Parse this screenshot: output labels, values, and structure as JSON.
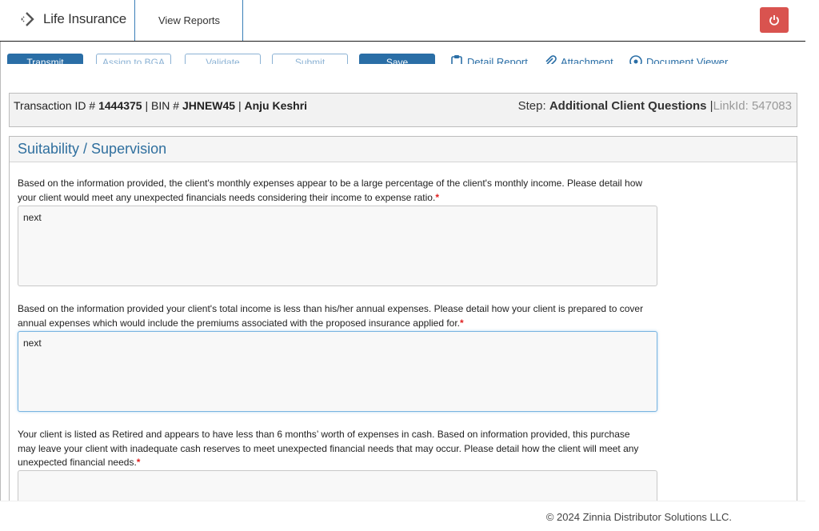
{
  "header": {
    "app_name": "Life Insurance",
    "nav_reports": "View Reports",
    "power_icon": "power-icon",
    "power_color": "#d9534f",
    "accent_color": "#2a6ea6"
  },
  "toolbar": {
    "buttons": [
      {
        "label": "Transmit",
        "style": "filled"
      },
      {
        "label": "Assign to BGA",
        "style": "outline"
      },
      {
        "label": "Validate",
        "style": "outline"
      },
      {
        "label": "Submit",
        "style": "outline"
      },
      {
        "label": "Save",
        "style": "filled"
      }
    ],
    "links": [
      {
        "label": "Detail Report",
        "icon": "clipboard-icon"
      },
      {
        "label": "Attachment",
        "icon": "paperclip-icon"
      },
      {
        "label": "Document Viewer",
        "icon": "eye-icon"
      }
    ]
  },
  "transaction": {
    "id_label": "Transaction ID #",
    "id_value": "1444375",
    "bin_label": "BIN #",
    "bin_value": "JHNEW45",
    "client_name": "Anju Keshri",
    "step_label": "Step:",
    "step_value": "Additional Client Questions",
    "link_id": "LinkId: 547083"
  },
  "section": {
    "title": "Suitability / Supervision",
    "questions": [
      {
        "text": "Based on the information provided, the client's monthly expenses appear to be a large percentage of the client's monthly income. Please detail how your client would meet any unexpected financials needs considering their income to expense ratio.",
        "required_mark": "*",
        "answer": "next"
      },
      {
        "text": "Based on the information provided your client's total income is less than his/her annual expenses. Please detail how your client is prepared to cover annual expenses which would include the premiums associated with the proposed insurance applied for.",
        "required_mark": "*",
        "answer": "next"
      },
      {
        "text": "Your client is listed as Retired and appears to have less than 6 months’ worth of expenses in cash. Based on information provided, this purchase may leave your client with inadequate cash reserves to meet unexpected financial needs that may occur. Please detail how the client will meet any unexpected financial needs.",
        "required_mark": "*",
        "answer": ""
      }
    ]
  },
  "footer": {
    "copyright": "© 2024 Zinnia Distributor Solutions LLC."
  }
}
